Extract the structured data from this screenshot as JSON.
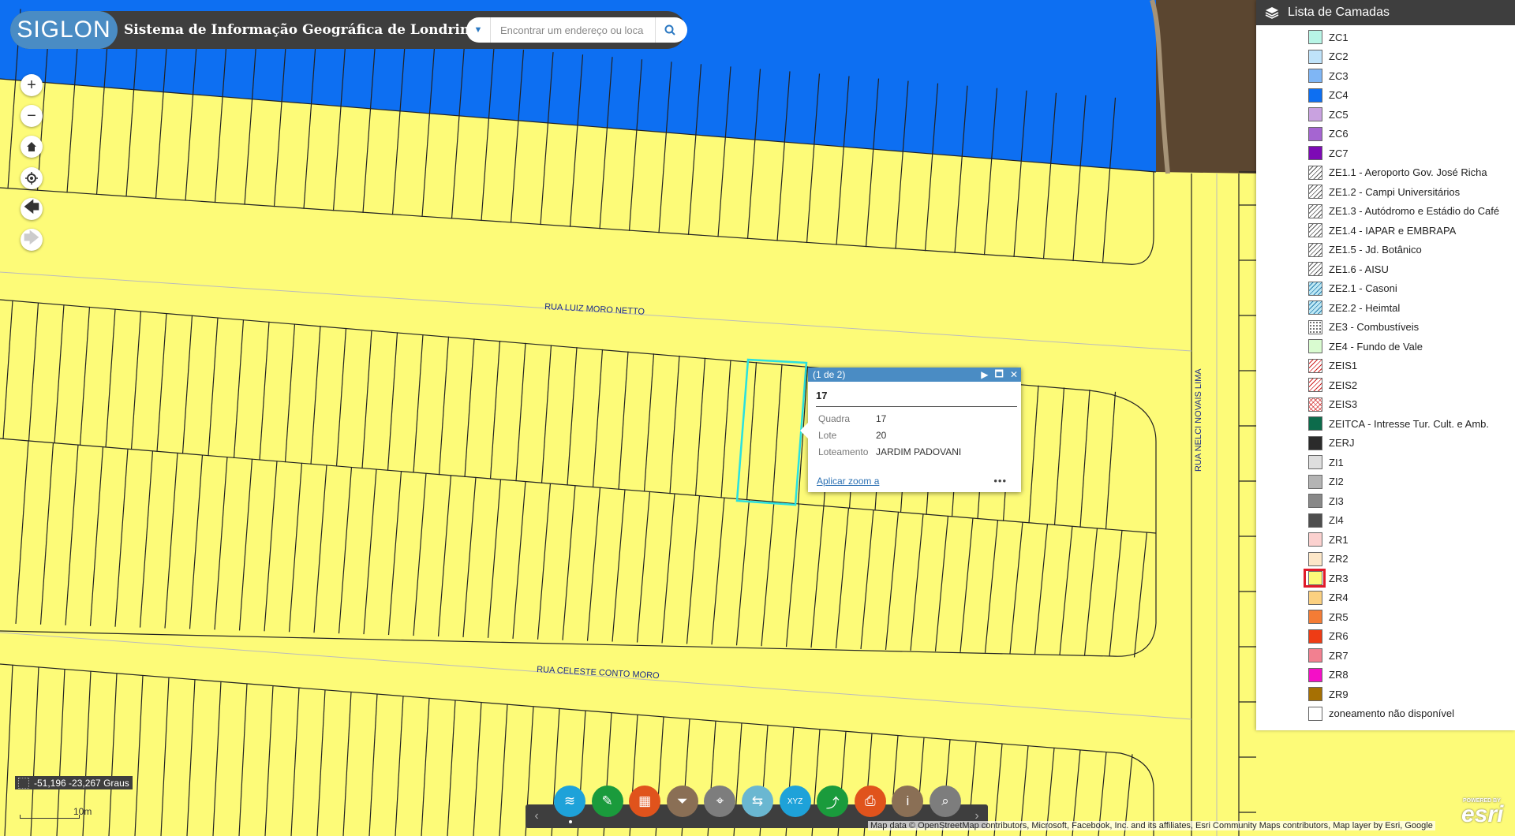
{
  "app": {
    "logo_text": "SIGLON",
    "title": "Sistema de Informação Geográfica de Londrina"
  },
  "search": {
    "placeholder": "Encontrar um endereço ou loca"
  },
  "map": {
    "streets": [
      "RUA LUIZ MORO NETTO",
      "RUA CELESTE CONTO MORO",
      "RUA NELCI NOVAIS LIMA"
    ],
    "colors": {
      "zone_yellow": "#fdfb78",
      "zone_blue": "#0d6ff2",
      "parcel_line": "#222222",
      "selection": "#29e0e0"
    }
  },
  "layers_panel": {
    "title": "Lista de Camadas",
    "items": [
      {
        "label": "ZC1",
        "color": "#b8f5e6"
      },
      {
        "label": "ZC2",
        "color": "#bfe3fa"
      },
      {
        "label": "ZC3",
        "color": "#7fb6f5"
      },
      {
        "label": "ZC4",
        "color": "#0d6ff2"
      },
      {
        "label": "ZC5",
        "color": "#c9a2e0"
      },
      {
        "label": "ZC6",
        "color": "#a565d1"
      },
      {
        "label": "ZC7",
        "color": "#7d0ab5"
      },
      {
        "label": "ZE1.1 - Aeroporto Gov. José Richa",
        "pattern": "hatch"
      },
      {
        "label": "ZE1.2 - Campi Universitários",
        "pattern": "hatch"
      },
      {
        "label": "ZE1.3 - Autódromo e Estádio do Café",
        "pattern": "hatch"
      },
      {
        "label": "ZE1.4 - IAPAR e EMBRAPA",
        "pattern": "hatch"
      },
      {
        "label": "ZE1.5 - Jd. Botânico",
        "pattern": "hatch"
      },
      {
        "label": "ZE1.6 - AISU",
        "pattern": "hatch"
      },
      {
        "label": "ZE2.1 - Casoni",
        "pattern": "hatch-blue"
      },
      {
        "label": "ZE2.2 - Heimtal",
        "pattern": "hatch-blue"
      },
      {
        "label": "ZE3 - Combustíveis",
        "pattern": "dots"
      },
      {
        "label": "ZE4 - Fundo de Vale",
        "color": "#d9fbd0"
      },
      {
        "label": "ZEIS1",
        "pattern": "hatch-red"
      },
      {
        "label": "ZEIS2",
        "pattern": "hatch-red"
      },
      {
        "label": "ZEIS3",
        "pattern": "hatch-redx"
      },
      {
        "label": "ZEITCA - Intresse Tur. Cult. e Amb.",
        "color": "#0c6b4b"
      },
      {
        "label": "ZERJ",
        "color": "#2b2b2b"
      },
      {
        "label": "ZI1",
        "color": "#dedede"
      },
      {
        "label": "ZI2",
        "color": "#b4b4b4"
      },
      {
        "label": "ZI3",
        "color": "#888888"
      },
      {
        "label": "ZI4",
        "color": "#4e4e4e"
      },
      {
        "label": "ZR1",
        "color": "#fbd1cf"
      },
      {
        "label": "ZR2",
        "color": "#fde7c8"
      },
      {
        "label": "ZR3",
        "color": "#fdfb78",
        "highlighted": true
      },
      {
        "label": "ZR4",
        "color": "#fbd080"
      },
      {
        "label": "ZR5",
        "color": "#f47c35"
      },
      {
        "label": "ZR6",
        "color": "#ee3c15"
      },
      {
        "label": "ZR7",
        "color": "#f28090"
      },
      {
        "label": "ZR8",
        "color": "#f40fc7"
      },
      {
        "label": "ZR9",
        "color": "#a67003"
      },
      {
        "label": "zoneamento não disponível",
        "color": "#ffffff"
      }
    ]
  },
  "popup": {
    "counter": "(1 de 2)",
    "title": "17",
    "attributes": [
      {
        "key": "Quadra",
        "value": "17"
      },
      {
        "key": "Lote",
        "value": "20"
      },
      {
        "key": "Loteamento",
        "value": "JARDIM PADOVANI"
      }
    ],
    "zoom_link": "Aplicar zoom a",
    "more": "•••"
  },
  "toolbar": {
    "tools": [
      {
        "icon": "layers-icon",
        "color": "#1ea2d9",
        "glyph": "≋"
      },
      {
        "icon": "measure-icon",
        "color": "#1a9b3c",
        "glyph": "✎"
      },
      {
        "icon": "basemap-gallery-icon",
        "color": "#e0531c",
        "glyph": "▦"
      },
      {
        "icon": "filter-icon",
        "color": "#8a6f55",
        "glyph": "⏷"
      },
      {
        "icon": "locate-address-icon",
        "color": "#7d7d7d",
        "glyph": "⌖"
      },
      {
        "icon": "swipe-icon",
        "color": "#6ab7d1",
        "glyph": "⇆"
      },
      {
        "icon": "xyz-coordinate-icon",
        "color": "#1ea2d9",
        "glyph": "XYZ"
      },
      {
        "icon": "share-icon",
        "color": "#1a9b3c",
        "glyph": "⤴"
      },
      {
        "icon": "print-icon",
        "color": "#e0531c",
        "glyph": "⎙"
      },
      {
        "icon": "info-icon",
        "color": "#8a6f55",
        "glyph": "i"
      },
      {
        "icon": "query-icon",
        "color": "#7d7d7d",
        "glyph": "⌕"
      }
    ],
    "prev": "‹",
    "next": "›"
  },
  "status": {
    "coordinates": "-51,196 -23,267 Graus",
    "scale": "10m",
    "attribution": "Map data © OpenStreetMap contributors, Microsoft, Facebook, Inc. and its affiliates, Esri Community Maps contributors, Map layer by Esri, Google",
    "esri_powered": "POWERED BY",
    "esri_logo": "esri"
  }
}
